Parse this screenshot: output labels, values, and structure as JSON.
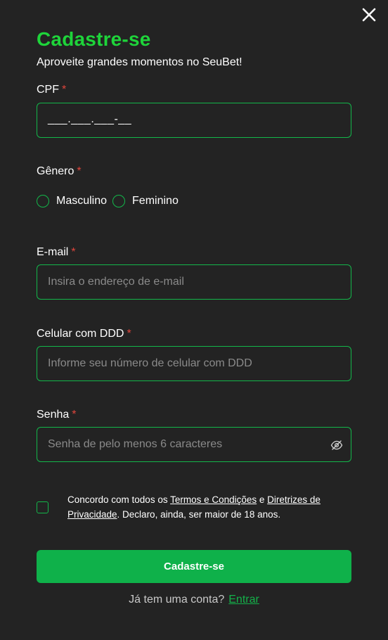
{
  "header": {
    "title": "Cadastre-se",
    "subtitle": "Aproveite grandes momentos no SeuBet!"
  },
  "form": {
    "required_mark": "*",
    "cpf": {
      "label": "CPF",
      "mask": "___.___.___-__"
    },
    "gender": {
      "label": "Gênero",
      "options": [
        "Masculino",
        "Feminino"
      ]
    },
    "email": {
      "label": "E-mail",
      "placeholder": "Insira o endereço de e-mail"
    },
    "phone": {
      "label": "Celular com DDD",
      "placeholder": "Informe seu número de celular com DDD"
    },
    "password": {
      "label": "Senha",
      "placeholder": "Senha de pelo menos 6 caracteres",
      "toggle_icon": "eye-off-icon"
    },
    "terms": {
      "prefix": "Concordo com todos os ",
      "terms_link": "Termos e Condições",
      "conjunction": " e ",
      "privacy_link": "Diretrizes de Privacidade",
      "suffix": ". Declaro, ainda, ser maior de 18 anos."
    },
    "submit_label": "Cadastre-se"
  },
  "footer": {
    "question": "Já tem uma conta?",
    "login_link": "Entrar"
  },
  "colors": {
    "background": "#232323",
    "accent_green": "#1ed43a",
    "button_green": "#0fb14a",
    "border_green": "#13b74a",
    "required_red": "#e0453c"
  }
}
